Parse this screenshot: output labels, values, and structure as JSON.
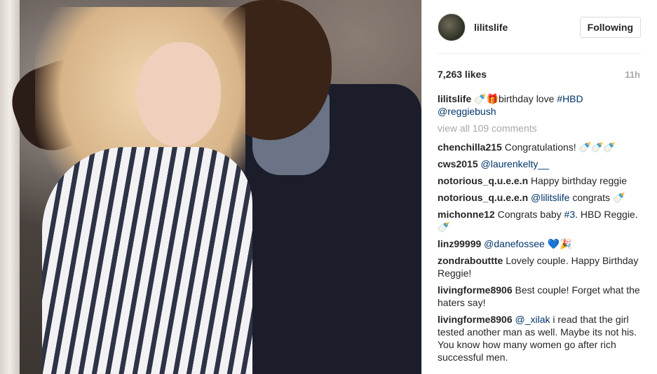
{
  "post": {
    "username": "lilitslife",
    "follow_label": "Following",
    "likes": "7,263 likes",
    "time": "11h",
    "caption": {
      "user": "lilitslife",
      "emoji": "🍼🎁",
      "text": "birthday love",
      "hashtag": "#HBD",
      "mention": "@reggiebush"
    },
    "view_all": "view all 109 comments"
  },
  "comments": [
    {
      "user": "chenchilla215",
      "text": "Congratulations!",
      "mention": "",
      "emoji": "🍼🍼🍼"
    },
    {
      "user": "cws2015",
      "text": "",
      "mention": "@laurenkelty__",
      "emoji": ""
    },
    {
      "user": "notorious_q.u.e.e.n",
      "text": "Happy birthday reggie",
      "mention": "",
      "emoji": ""
    },
    {
      "user": "notorious_q.u.e.e.n",
      "text": "congrats",
      "mention": "@lilitslife",
      "emoji": "🍼"
    },
    {
      "user": "michonne12",
      "text": "Congrats baby",
      "mention": "#3",
      "text2": ". HBD Reggie.",
      "emoji": "🍼"
    },
    {
      "user": "linz99999",
      "text": "",
      "mention": "@danefossee",
      "emoji": "💙🎉"
    },
    {
      "user": "zondrabouttte",
      "text": "Lovely couple. Happy Birthday Reggie!",
      "mention": "",
      "emoji": ""
    },
    {
      "user": "livingforme8906",
      "text": "Best couple! Forget what the haters say!",
      "mention": "",
      "emoji": ""
    },
    {
      "user": "livingforme8906",
      "text": "i read that the girl tested another man as well. Maybe its not his. You know how many women go after rich successful men.",
      "mention": "@_xilak",
      "emoji": ""
    }
  ]
}
